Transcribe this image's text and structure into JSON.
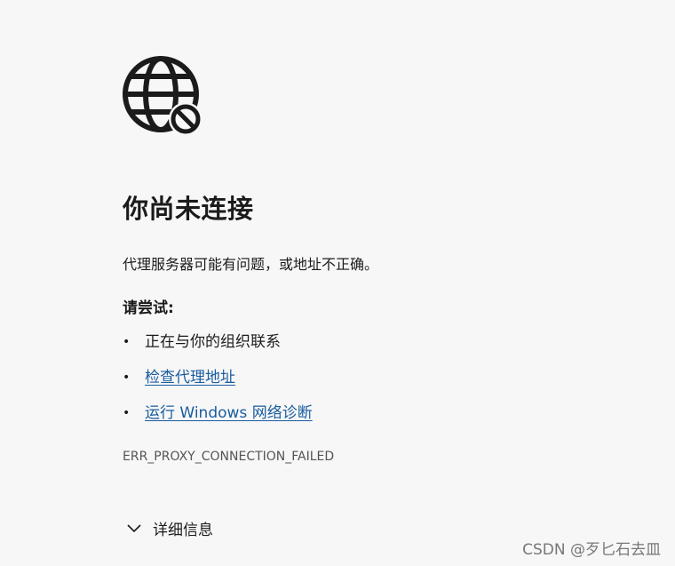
{
  "error_page": {
    "icon": "globe-blocked-icon",
    "title": "你尚未连接",
    "description": "代理服务器可能有问题，或地址不正确。",
    "try_label": "请尝试:",
    "suggestions": [
      {
        "text": "正在与你的组织联系",
        "is_link": false
      },
      {
        "text": "检查代理地址",
        "is_link": true
      },
      {
        "text": "运行 Windows 网络诊断",
        "is_link": true
      }
    ],
    "bullet": "•",
    "error_code": "ERR_PROXY_CONNECTION_FAILED",
    "details_label": "详细信息",
    "details_icon": "chevron-down-icon"
  },
  "watermark": "CSDN @歹匕石去皿",
  "colors": {
    "background": "#f7f7f7",
    "text": "#1b1b1b",
    "link": "#1a5c9e",
    "error_code": "#555555"
  }
}
